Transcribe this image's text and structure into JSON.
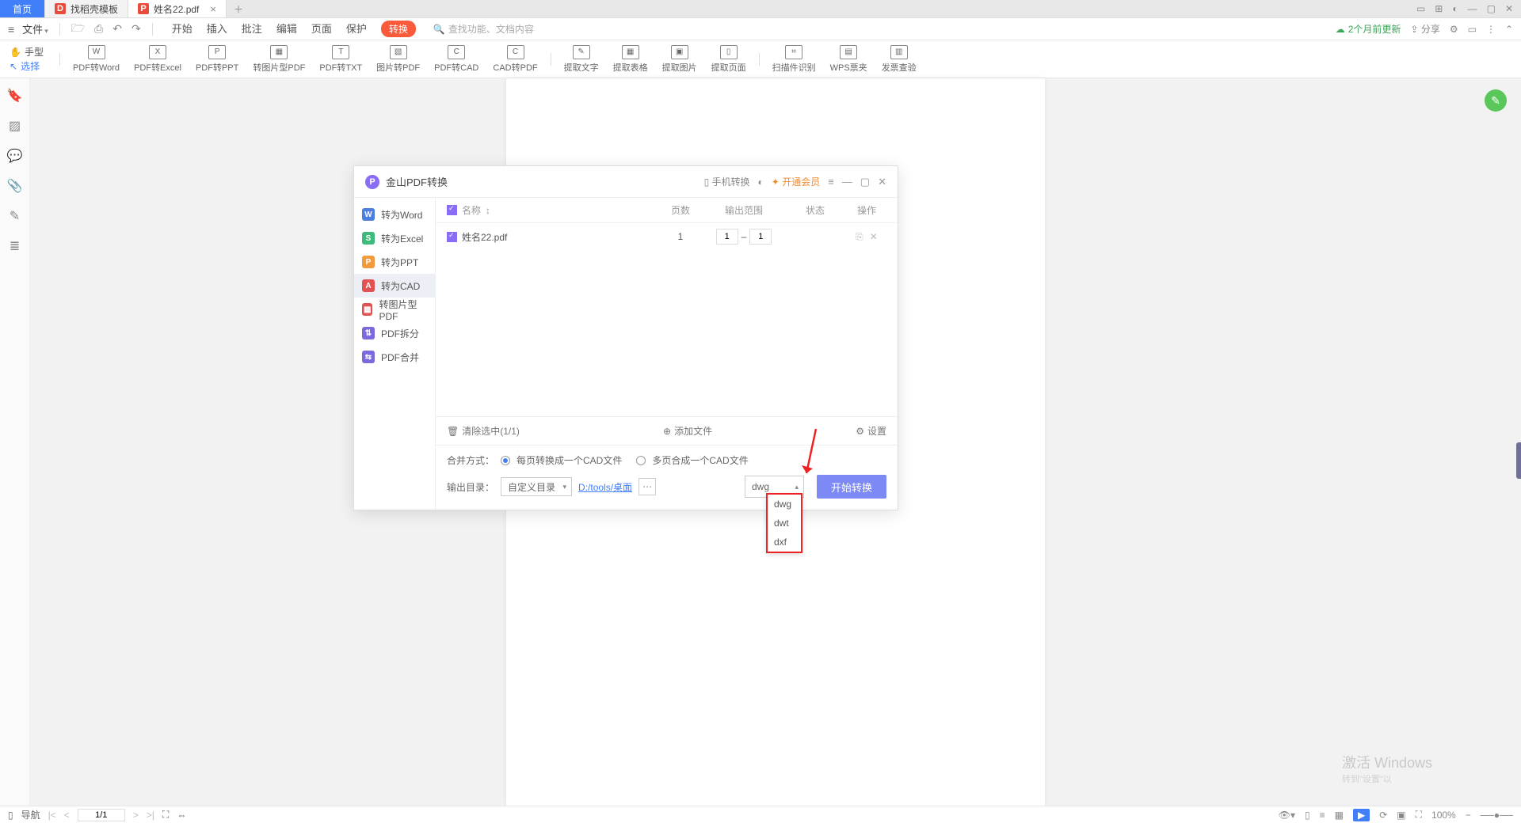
{
  "tabs": {
    "home": "首页",
    "template": "找稻壳模板",
    "active": "姓名22.pdf"
  },
  "fileMenu": "文件",
  "topMenus": [
    "开始",
    "插入",
    "批注",
    "编辑",
    "页面",
    "保护"
  ],
  "convertLabel": "转换",
  "searchPlaceholder": "查找功能、文档内容",
  "syncText": "2个月前更新",
  "shareText": "分享",
  "toolHand": "手型",
  "toolSelect": "选择",
  "ribbon": [
    "PDF转Word",
    "PDF转Excel",
    "PDF转PPT",
    "转图片型PDF",
    "PDF转TXT",
    "图片转PDF",
    "PDF转CAD",
    "CAD转PDF",
    "提取文字",
    "提取表格",
    "提取图片",
    "提取页面",
    "扫描件识别",
    "WPS票夹",
    "发票查验"
  ],
  "dialog": {
    "title": "金山PDF转换",
    "mobile": "手机转换",
    "vip": "开通会员",
    "side": [
      "转为Word",
      "转为Excel",
      "转为PPT",
      "转为CAD",
      "转图片型PDF",
      "PDF拆分",
      "PDF合并"
    ],
    "thead": {
      "name": "名称",
      "arrow": "↕",
      "pages": "页数",
      "range": "输出范围",
      "status": "状态",
      "ops": "操作"
    },
    "row": {
      "file": "姓名22.pdf",
      "pages": "1",
      "from": "1",
      "to": "1"
    },
    "clear": "清除选中(1/1)",
    "add": "添加文件",
    "settings": "设置",
    "mergeLabel": "合并方式：",
    "mergeOpt1": "每页转换成一个CAD文件",
    "mergeOpt2": "多页合成一个CAD文件",
    "outLabel": "输出目录：",
    "outDir": "自定义目录",
    "outPath": "D:/tools/桌面",
    "fmtSelected": "dwg",
    "start": "开始转换",
    "opts": [
      "dwg",
      "dwt",
      "dxf"
    ]
  },
  "status": {
    "nav": "导航",
    "page": "1/1",
    "zoom": "100%"
  },
  "watermark": {
    "line1": "激活 Windows",
    "line2": "转到\"设置\"以"
  }
}
